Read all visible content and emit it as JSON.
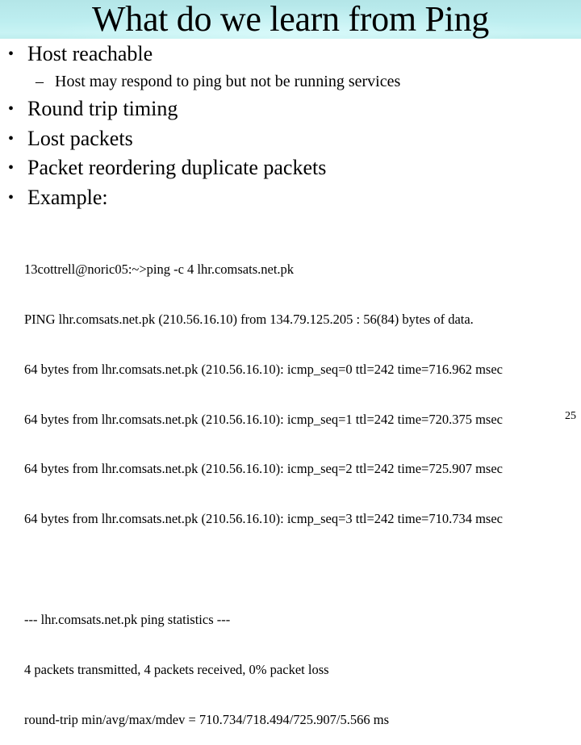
{
  "slide": {
    "title": "What do we learn from Ping",
    "page_number": "25",
    "colors": {
      "title_band": "#b8e8ea",
      "text": "#000000",
      "background": "#ffffff"
    }
  },
  "bullets": [
    {
      "label": "Host reachable",
      "sub_items": [
        "Host may respond to ping but not be running services"
      ]
    },
    {
      "label": "Round trip timing",
      "sub_items": []
    },
    {
      "label": "Lost packets",
      "sub_items": []
    },
    {
      "label": "Packet reordering duplicate packets",
      "sub_items": []
    },
    {
      "label": "Example:",
      "sub_items": []
    }
  ],
  "bullet_glyph": "•",
  "sub_bullet_glyph": "–",
  "ping_example": {
    "command": "13cottrell@noric05:~>ping -c 4 lhr.comsats.net.pk",
    "header": "PING lhr.comsats.net.pk (210.56.16.10) from 134.79.125.205 : 56(84) bytes of data.",
    "replies": [
      "64 bytes from lhr.comsats.net.pk (210.56.16.10): icmp_seq=0 ttl=242 time=716.962 msec",
      "64 bytes from lhr.comsats.net.pk (210.56.16.10): icmp_seq=1 ttl=242 time=720.375 msec",
      "64 bytes from lhr.comsats.net.pk (210.56.16.10): icmp_seq=2 ttl=242 time=725.907 msec",
      "64 bytes from lhr.comsats.net.pk (210.56.16.10): icmp_seq=3 ttl=242 time=710.734 msec"
    ],
    "statistics": [
      "--- lhr.comsats.net.pk ping statistics ---",
      "4 packets transmitted, 4 packets received, 0% packet loss",
      "round-trip min/avg/max/mdev = 710.734/718.494/725.907/5.566 ms"
    ]
  }
}
